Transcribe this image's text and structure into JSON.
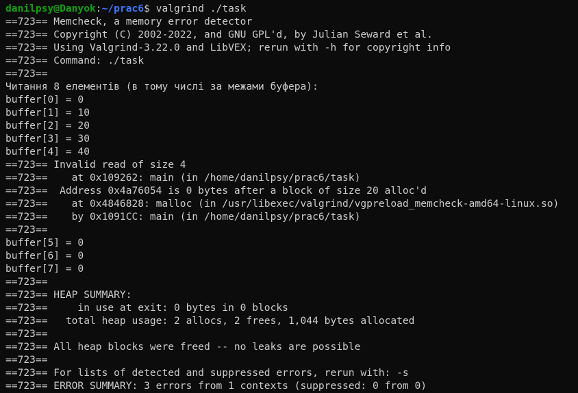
{
  "terminal": {
    "colors": {
      "background": "#0c0c0c",
      "text": "#cccccc",
      "prompt_user": "#13a10e",
      "prompt_path": "#3b78ff"
    },
    "prompt": {
      "user_host": "danilpsy@Danyok",
      "separator": ":",
      "path": "~/prac6",
      "symbol": "$ ",
      "command": "valgrind ./task"
    },
    "output_lines": [
      "==723== Memcheck, a memory error detector",
      "==723== Copyright (C) 2002-2022, and GNU GPL'd, by Julian Seward et al.",
      "==723== Using Valgrind-3.22.0 and LibVEX; rerun with -h for copyright info",
      "==723== Command: ./task",
      "==723==",
      "Читання 8 елементів (в тому числі за межами буфера):",
      "buffer[0] = 0",
      "buffer[1] = 10",
      "buffer[2] = 20",
      "buffer[3] = 30",
      "buffer[4] = 40",
      "==723== Invalid read of size 4",
      "==723==    at 0x109262: main (in /home/danilpsy/prac6/task)",
      "==723==  Address 0x4a76054 is 0 bytes after a block of size 20 alloc'd",
      "==723==    at 0x4846828: malloc (in /usr/libexec/valgrind/vgpreload_memcheck-amd64-linux.so)",
      "==723==    by 0x1091CC: main (in /home/danilpsy/prac6/task)",
      "==723==",
      "buffer[5] = 0",
      "buffer[6] = 0",
      "buffer[7] = 0",
      "==723==",
      "==723== HEAP SUMMARY:",
      "==723==     in use at exit: 0 bytes in 0 blocks",
      "==723==   total heap usage: 2 allocs, 2 frees, 1,044 bytes allocated",
      "==723==",
      "==723== All heap blocks were freed -- no leaks are possible",
      "==723==",
      "==723== For lists of detected and suppressed errors, rerun with: -s",
      "==723== ERROR SUMMARY: 3 errors from 1 contexts (suppressed: 0 from 0)"
    ]
  }
}
